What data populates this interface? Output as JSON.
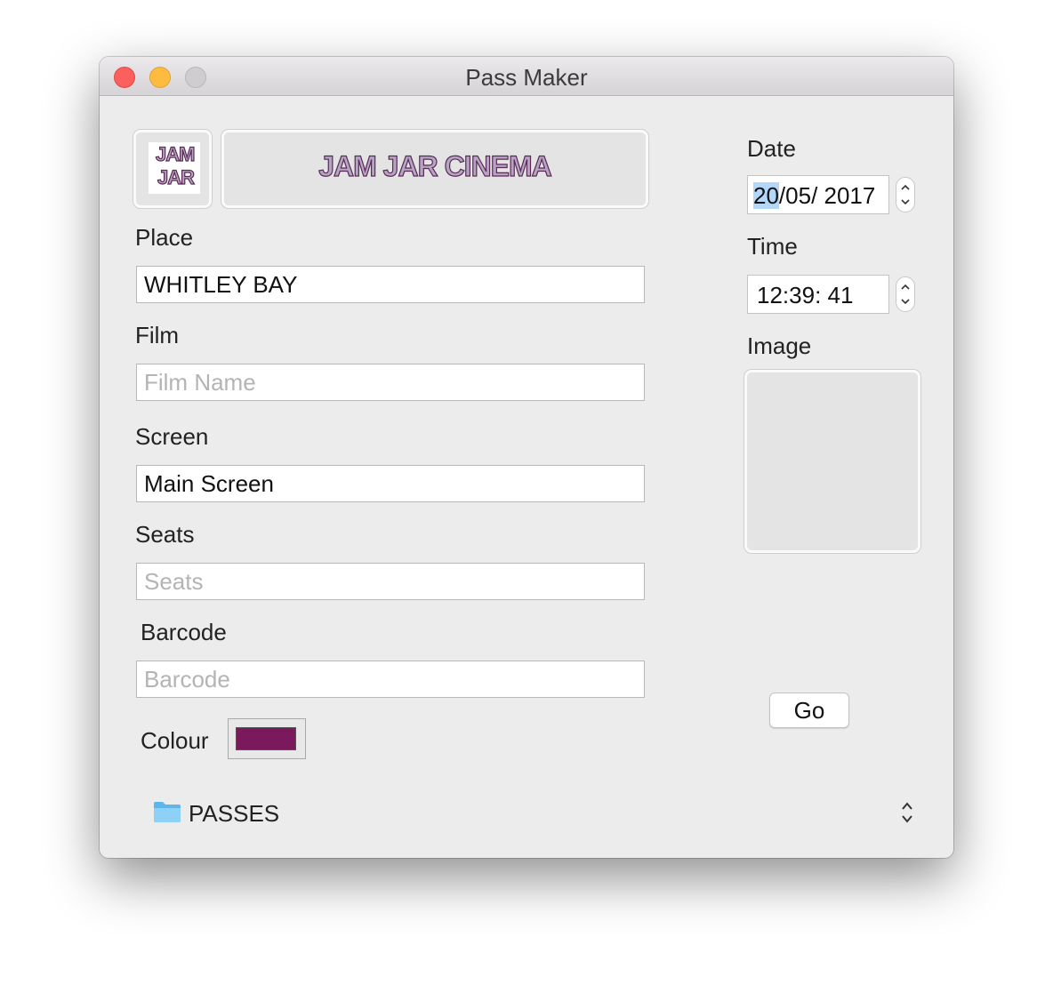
{
  "window": {
    "title": "Pass Maker"
  },
  "logos": {
    "small_line1": "JAM",
    "small_line2": "JAR",
    "banner": "JAM JAR CINEMA"
  },
  "form": {
    "place": {
      "label": "Place",
      "value": "WHITLEY BAY",
      "placeholder": ""
    },
    "film": {
      "label": "Film",
      "value": "",
      "placeholder": "Film Name"
    },
    "screen": {
      "label": "Screen",
      "value": "Main Screen",
      "placeholder": ""
    },
    "seats": {
      "label": "Seats",
      "value": "",
      "placeholder": "Seats"
    },
    "barcode": {
      "label": "Barcode",
      "value": "",
      "placeholder": "Barcode"
    },
    "colour": {
      "label": "Colour",
      "value": "#7a1a5c"
    }
  },
  "date": {
    "label": "Date",
    "day": "20",
    "rest": "/05/ 2017"
  },
  "time": {
    "label": "Time",
    "value": "12:39: 41"
  },
  "image": {
    "label": "Image"
  },
  "go": {
    "label": "Go"
  },
  "folder": {
    "name": "PASSES",
    "icon": "folder-icon"
  }
}
